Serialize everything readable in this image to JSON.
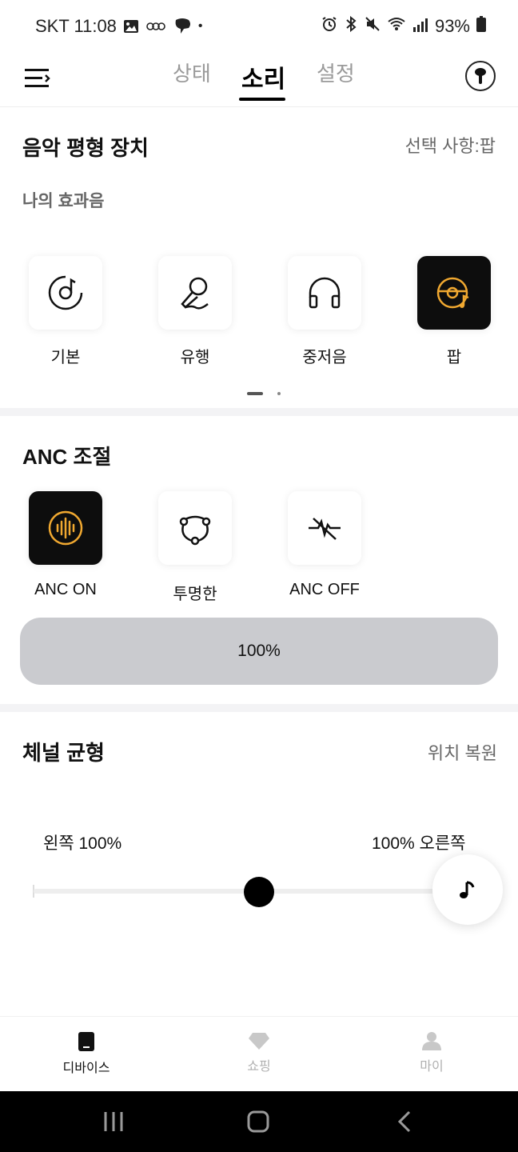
{
  "status_bar": {
    "carrier_time": "SKT 11:08",
    "dot": "•",
    "battery": "93%",
    "icons_left": [
      "image-icon",
      "voicemail-icon",
      "chat-bubble-icon"
    ],
    "icons_right": [
      "alarm-icon",
      "bluetooth-icon",
      "mute-icon",
      "wifi-icon",
      "signal-icon",
      "battery-icon"
    ]
  },
  "header": {
    "tabs": [
      {
        "label": "상태",
        "active": false
      },
      {
        "label": "소리",
        "active": true
      },
      {
        "label": "설정",
        "active": false
      }
    ]
  },
  "eq": {
    "title": "음악 평형 장치",
    "selection": "선택 사항:팝",
    "subtitle": "나의 효과음",
    "presets": [
      {
        "label": "기본",
        "icon": "music-disc-icon",
        "selected": false
      },
      {
        "label": "유행",
        "icon": "microphone-icon",
        "selected": false
      },
      {
        "label": "중저음",
        "icon": "headphones-icon",
        "selected": false
      },
      {
        "label": "팝",
        "icon": "pop-disc-icon",
        "selected": true
      }
    ],
    "pager": {
      "current": 1,
      "total": 2
    }
  },
  "anc": {
    "title": "ANC 조절",
    "modes": [
      {
        "label": "ANC ON",
        "icon": "soundwave-icon",
        "selected": true
      },
      {
        "label": "투명한",
        "icon": "transparency-icon",
        "selected": false
      },
      {
        "label": "ANC OFF",
        "icon": "anc-off-icon",
        "selected": false
      }
    ],
    "level": "100%"
  },
  "balance": {
    "title": "체널 균형",
    "reset": "위치 복원",
    "left_label": "왼쪽 100%",
    "right_label": "100% 오른쪽",
    "position": 0.5
  },
  "bottom_nav": [
    {
      "label": "디바이스",
      "icon": "device-icon",
      "active": true
    },
    {
      "label": "쇼핑",
      "icon": "diamond-icon",
      "active": false
    },
    {
      "label": "마이",
      "icon": "person-icon",
      "active": false
    }
  ],
  "colors": {
    "accent": "#f0a830",
    "selected_tile": "#0d0d0d",
    "level_bar": "#cacbcf"
  }
}
